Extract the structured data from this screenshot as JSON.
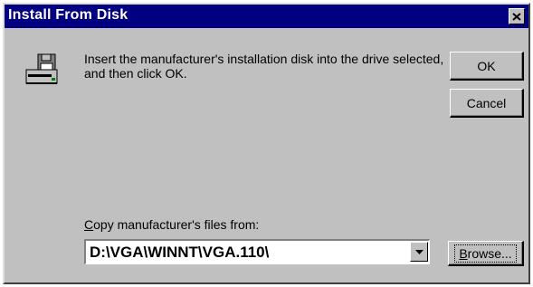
{
  "window": {
    "title": "Install From Disk",
    "close_icon": "close-icon"
  },
  "message": {
    "icon": "floppy-drive-icon",
    "text": "Insert the manufacturer's installation disk into the drive selected, and then click OK."
  },
  "buttons": {
    "ok_label": "OK",
    "cancel_label": "Cancel",
    "browse_label_mnemonic": "B",
    "browse_label_rest": "rowse..."
  },
  "copy_from": {
    "label_mnemonic": "C",
    "label_rest": "opy manufacturer's files from:",
    "value": "D:\\VGA\\WINNT\\VGA.110\\",
    "dropdown_icon": "chevron-down-icon"
  },
  "colors": {
    "titlebar": "#000080",
    "face": "#c0c0c0"
  }
}
